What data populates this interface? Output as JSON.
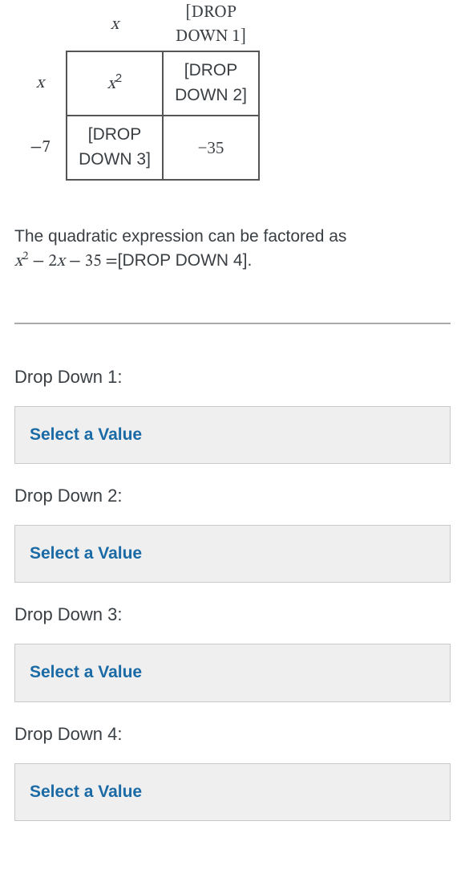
{
  "table": {
    "col_heads": {
      "c1": "x",
      "c2": "[DROP DOWN 1]"
    },
    "row_heads": {
      "r1": "x",
      "r2": "−7"
    },
    "cells": {
      "r1c1_var": "x",
      "r1c1_exp": "2",
      "r1c2": "[DROP DOWN 2]",
      "r2c1": "[DROP DOWN 3]",
      "r2c2": "−35"
    }
  },
  "prose": {
    "intro": "The quadratic expression can be factored as",
    "eq_var": "x",
    "eq_exp": "2",
    "eq_mid": " − 2",
    "eq_var2": "x",
    "eq_tail": " − 35 =",
    "eq_slot": "[DROP DOWN 4]",
    "eq_end": "."
  },
  "dropdowns": {
    "label1": "Drop Down 1:",
    "label2": "Drop Down 2:",
    "label3": "Drop Down 3:",
    "label4": "Drop Down 4:",
    "placeholder": "Select a Value"
  }
}
